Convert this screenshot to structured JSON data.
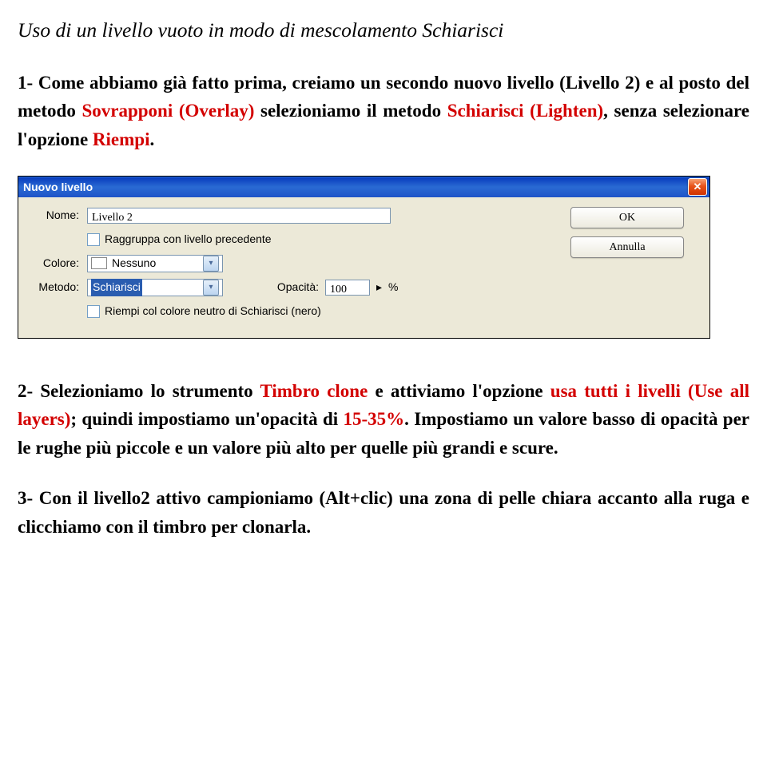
{
  "heading": "Uso di un livello vuoto in modo di mescolamento Schiarisci",
  "para1": {
    "t1": "1- Come abbiamo già fatto prima, creiamo un secondo nuovo livello (Livello 2) e al posto del metodo ",
    "t2": "Sovrapponi (Overlay)",
    "t3": " selezioniamo il metodo ",
    "t4": "Schiarisci (Lighten)",
    "t5": ", senza selezionare l'opzione ",
    "t6": "Riempi",
    "t7": "."
  },
  "dialog": {
    "title": "Nuovo livello",
    "close": "✕",
    "labels": {
      "nome": "Nome:",
      "colore": "Colore:",
      "metodo": "Metodo:",
      "opacita": "Opacità:"
    },
    "fields": {
      "nome": "Livello 2",
      "group": "Raggruppa con livello precedente",
      "colore": "Nessuno",
      "metodo": "Schiarisci",
      "opacita": "100",
      "opacita_unit": "%",
      "fill": "Riempi col colore neutro di Schiarisci (nero)"
    },
    "buttons": {
      "ok": "OK",
      "cancel": "Annulla"
    }
  },
  "para2": {
    "t1": "2- Selezioniamo lo strumento ",
    "t2": "Timbro clone",
    "t3": " e attiviamo l'opzione ",
    "t4": "usa tutti i livelli (Use all layers)",
    "t5": "; quindi impostiamo un'opacità di ",
    "t6": "15-35%",
    "t7": ". Impostiamo un valore basso di opacità per le rughe più piccole e un valore più alto per quelle più grandi e scure."
  },
  "para3": "3- Con il livello2 attivo campioniamo (Alt+clic) una zona di pelle chiara accanto alla ruga e clicchiamo con il timbro per clonarla."
}
